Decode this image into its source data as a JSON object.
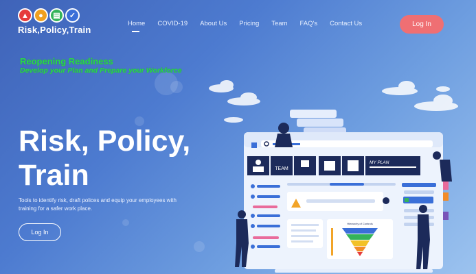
{
  "brand": {
    "name": "Risk,Policy,Train",
    "icons": [
      "warning-icon",
      "person-icon",
      "chart-icon",
      "check-icon"
    ],
    "icon_colors": [
      "#e63b3b",
      "#f0a020",
      "#34b35a",
      "#3a6fd8"
    ]
  },
  "nav": {
    "items": [
      {
        "label": "Home",
        "active": true
      },
      {
        "label": "COVID-19",
        "active": false
      },
      {
        "label": "About Us",
        "active": false
      },
      {
        "label": "Pricing",
        "active": false
      },
      {
        "label": "Team",
        "active": false
      },
      {
        "label": "FAQ's",
        "active": false
      },
      {
        "label": "Contact Us",
        "active": false
      }
    ],
    "login_label": "Log In"
  },
  "hero": {
    "banner_title": "Reopening Readiness",
    "banner_subtitle": "Develop your Plan and Prepare your Workforce",
    "title": "Risk, Policy, Train",
    "description": "Tools to identify risk, draft polices and equip your employees with training for a safer work place.",
    "login_label": "Log In"
  },
  "illustration": {
    "toolbar_labels": [
      "TEAM",
      "MY PLAN"
    ],
    "chart_title": "Hierarchy of Controls"
  },
  "colors": {
    "accent_green": "#2bd64d",
    "login_coral": "#ef6f73",
    "navy": "#1c2a5a"
  }
}
